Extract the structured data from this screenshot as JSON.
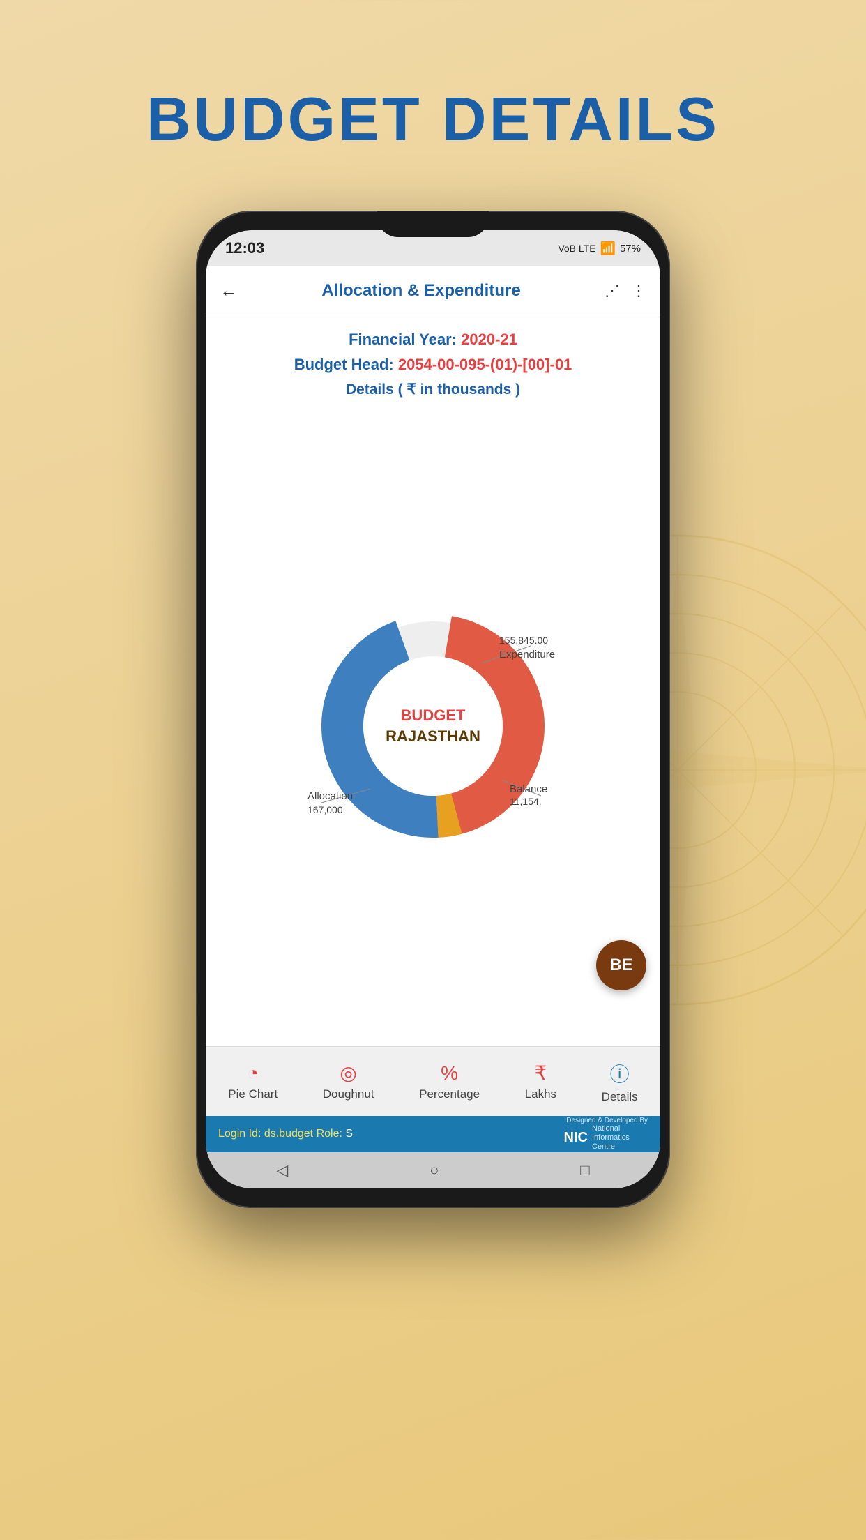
{
  "page": {
    "title": "BUDGET DETAILS",
    "background_color": "#e8c87a"
  },
  "status_bar": {
    "time": "12:03",
    "icons": "VoB LTE LTE1 ↑↓ .ill 57% 🔋",
    "battery": "57%"
  },
  "header": {
    "title": "Allocation & Expenditure",
    "back_label": "←",
    "share_label": "share",
    "menu_label": "⋮"
  },
  "info": {
    "financial_year_label": "Financial Year:",
    "financial_year_value": "2020-21",
    "budget_head_label": "Budget Head:",
    "budget_head_value": "2054-00-095-(01)-[00]-01",
    "details_label": "Details ( ₹ in thousands )"
  },
  "chart": {
    "center_line1": "BUDGET",
    "center_line2": "RAJASTHAN",
    "segments": [
      {
        "label": "Allocation",
        "value": "167,000",
        "color": "#e05a44",
        "percentage": 50
      },
      {
        "label": "Expenditure",
        "value": "155,845.00",
        "color": "#3e7fc0",
        "percentage": 46.5
      },
      {
        "label": "Balance",
        "value": "11,154.",
        "color": "#e8a020",
        "percentage": 3.5
      }
    ]
  },
  "be_button": {
    "label": "BE"
  },
  "bottom_nav": {
    "items": [
      {
        "id": "pie-chart",
        "icon": "🥧",
        "label": "Pie Chart",
        "active": false
      },
      {
        "id": "doughnut",
        "icon": "🍩",
        "label": "Doughnut",
        "active": true
      },
      {
        "id": "percentage",
        "icon": "%",
        "label": "Percentage",
        "active": false
      },
      {
        "id": "lakhs",
        "icon": "₹",
        "label": "Lakhs",
        "active": false
      },
      {
        "id": "details",
        "icon": "ℹ",
        "label": "Details",
        "active": false
      }
    ]
  },
  "footer": {
    "login_label": "Login Id:",
    "login_value": "ds.budget",
    "role_label": "Role:",
    "role_value": "S",
    "designed_by": "Designed & Developed By",
    "nic_label": "NIC",
    "nic_full": "National Informatics Centre"
  },
  "sys_nav": {
    "back": "◁",
    "home": "○",
    "recent": "□"
  }
}
